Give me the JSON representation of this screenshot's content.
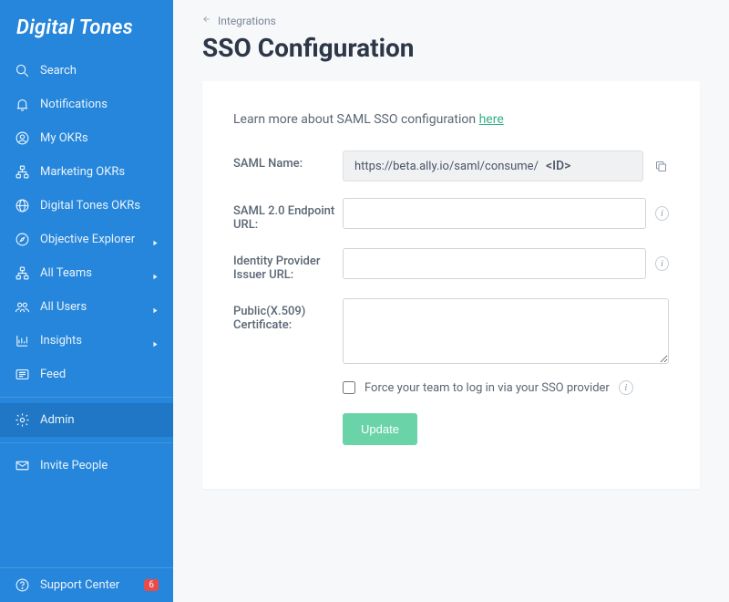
{
  "brand": "Digital Tones",
  "sidebar": {
    "items": [
      {
        "label": "Search",
        "icon": "search"
      },
      {
        "label": "Notifications",
        "icon": "bell"
      },
      {
        "label": "My OKRs",
        "icon": "user-circle"
      },
      {
        "label": "Marketing OKRs",
        "icon": "tree"
      },
      {
        "label": "Digital Tones OKRs",
        "icon": "globe"
      },
      {
        "label": "Objective Explorer",
        "icon": "compass",
        "caret": true
      },
      {
        "label": "All Teams",
        "icon": "teams-tree",
        "caret": true
      },
      {
        "label": "All Users",
        "icon": "users",
        "caret": true
      },
      {
        "label": "Insights",
        "icon": "chart",
        "caret": true
      },
      {
        "label": "Feed",
        "icon": "feed"
      },
      {
        "label": "Admin",
        "icon": "gear",
        "active": true
      }
    ],
    "invite": {
      "label": "Invite People",
      "icon": "mail"
    },
    "support": {
      "label": "Support Center",
      "icon": "help",
      "badge": "6"
    }
  },
  "breadcrumb": {
    "back_label": "Integrations"
  },
  "page": {
    "title": "SSO Configuration"
  },
  "info": {
    "learn_prefix": "Learn more about SAML SSO configuration ",
    "learn_link": "here"
  },
  "form": {
    "saml_name": {
      "label": "SAML Name:",
      "url_prefix": "https://beta.ally.io/saml/consume/",
      "id_slot": "<ID>"
    },
    "endpoint": {
      "label": "SAML 2.0 Endpoint URL:",
      "value": ""
    },
    "issuer": {
      "label": "Identity Provider Issuer URL:",
      "value": ""
    },
    "cert": {
      "label": "Public(X.509) Certificate:",
      "value": ""
    },
    "force_sso": {
      "label": "Force your team to log in via your SSO provider",
      "checked": false
    },
    "submit_label": "Update"
  }
}
